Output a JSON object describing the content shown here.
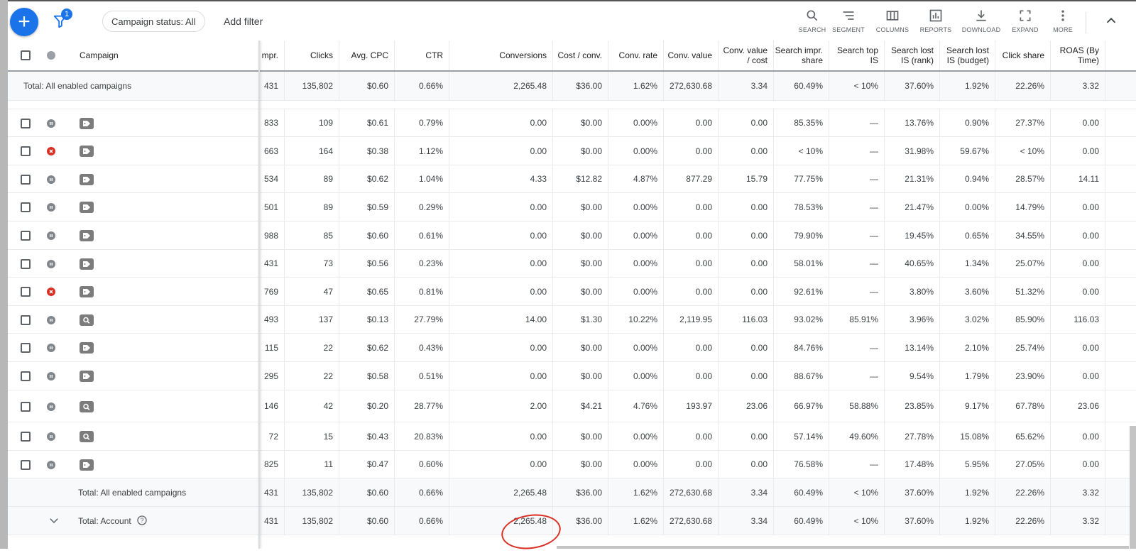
{
  "toolbar": {
    "filter_count": "1",
    "status_chip": "Campaign status: All",
    "add_filter": "Add filter",
    "tools": [
      {
        "name": "search",
        "label": "SEARCH"
      },
      {
        "name": "segment",
        "label": "SEGMENT"
      },
      {
        "name": "columns",
        "label": "COLUMNS"
      },
      {
        "name": "reports",
        "label": "REPORTS"
      },
      {
        "name": "download",
        "label": "DOWNLOAD"
      },
      {
        "name": "expand",
        "label": "EXPAND"
      },
      {
        "name": "more",
        "label": "MORE"
      }
    ]
  },
  "table": {
    "campaign_header": "Campaign",
    "columns": [
      "mpr.",
      "Clicks",
      "Avg. CPC",
      "CTR",
      "Conversions",
      "Cost / conv.",
      "Conv. rate",
      "Conv. value",
      "Conv. value / cost",
      "Search impr. share",
      "Search top IS",
      "Search lost IS (rank)",
      "Search lost IS (budget)",
      "Click share",
      "ROAS (By Time)"
    ],
    "top_total": {
      "label": "Total: All enabled campaigns",
      "values": [
        "431",
        "135,802",
        "$0.60",
        "0.66%",
        "2,265.48",
        "$36.00",
        "1.62%",
        "272,630.68",
        "3.34",
        "60.49%",
        "< 10%",
        "37.60%",
        "1.92%",
        "22.26%",
        "3.32"
      ]
    },
    "rows": [
      {
        "status": "paused",
        "type": "tag",
        "values": [
          "833",
          "109",
          "$0.61",
          "0.79%",
          "0.00",
          "$0.00",
          "0.00%",
          "0.00",
          "0.00",
          "85.35%",
          "—",
          "13.76%",
          "0.90%",
          "27.37%",
          "0.00"
        ]
      },
      {
        "status": "removed",
        "type": "tag",
        "values": [
          "663",
          "164",
          "$0.38",
          "1.12%",
          "0.00",
          "$0.00",
          "0.00%",
          "0.00",
          "0.00",
          "< 10%",
          "—",
          "31.98%",
          "59.67%",
          "< 10%",
          "0.00"
        ]
      },
      {
        "status": "paused",
        "type": "tag",
        "values": [
          "534",
          "89",
          "$0.62",
          "1.04%",
          "4.33",
          "$12.82",
          "4.87%",
          "877.29",
          "15.79",
          "77.75%",
          "—",
          "21.31%",
          "0.94%",
          "28.57%",
          "14.11"
        ]
      },
      {
        "status": "paused",
        "type": "tag",
        "values": [
          "501",
          "89",
          "$0.59",
          "0.29%",
          "0.00",
          "$0.00",
          "0.00%",
          "0.00",
          "0.00",
          "78.53%",
          "—",
          "21.47%",
          "0.00%",
          "14.79%",
          "0.00"
        ]
      },
      {
        "status": "paused",
        "type": "tag",
        "values": [
          "988",
          "85",
          "$0.60",
          "0.61%",
          "0.00",
          "$0.00",
          "0.00%",
          "0.00",
          "0.00",
          "79.90%",
          "—",
          "19.45%",
          "0.65%",
          "34.55%",
          "0.00"
        ]
      },
      {
        "status": "paused",
        "type": "tag",
        "values": [
          "431",
          "73",
          "$0.56",
          "0.23%",
          "0.00",
          "$0.00",
          "0.00%",
          "0.00",
          "0.00",
          "58.01%",
          "—",
          "40.65%",
          "1.34%",
          "25.07%",
          "0.00"
        ]
      },
      {
        "status": "removed",
        "type": "tag",
        "values": [
          "769",
          "47",
          "$0.65",
          "0.81%",
          "0.00",
          "$0.00",
          "0.00%",
          "0.00",
          "0.00",
          "92.61%",
          "—",
          "3.80%",
          "3.60%",
          "51.32%",
          "0.00"
        ]
      },
      {
        "status": "paused",
        "type": "search",
        "values": [
          "493",
          "137",
          "$0.13",
          "27.79%",
          "14.00",
          "$1.30",
          "10.22%",
          "2,119.95",
          "116.03",
          "93.02%",
          "85.91%",
          "3.96%",
          "3.02%",
          "85.90%",
          "116.03"
        ]
      },
      {
        "status": "paused",
        "type": "tag",
        "values": [
          "115",
          "22",
          "$0.62",
          "0.43%",
          "0.00",
          "$0.00",
          "0.00%",
          "0.00",
          "0.00",
          "84.76%",
          "—",
          "13.14%",
          "2.10%",
          "25.74%",
          "0.00"
        ]
      },
      {
        "status": "paused",
        "type": "tag",
        "values": [
          "295",
          "22",
          "$0.58",
          "0.51%",
          "0.00",
          "$0.00",
          "0.00%",
          "0.00",
          "0.00",
          "88.67%",
          "—",
          "9.54%",
          "1.79%",
          "23.90%",
          "0.00"
        ]
      },
      {
        "status": "paused",
        "type": "search",
        "values": [
          "146",
          "42",
          "$0.20",
          "28.77%",
          "2.00",
          "$4.21",
          "4.76%",
          "193.97",
          "23.06",
          "66.97%",
          "58.88%",
          "23.85%",
          "9.17%",
          "67.78%",
          "23.06"
        ]
      },
      {
        "status": "paused",
        "type": "search",
        "values": [
          "72",
          "15",
          "$0.43",
          "20.83%",
          "0.00",
          "$0.00",
          "0.00%",
          "0.00",
          "0.00",
          "57.14%",
          "49.60%",
          "27.78%",
          "15.08%",
          "65.62%",
          "0.00"
        ]
      },
      {
        "status": "paused",
        "type": "tag",
        "values": [
          "825",
          "11",
          "$0.47",
          "0.60%",
          "0.00",
          "$0.00",
          "0.00%",
          "0.00",
          "0.00",
          "76.58%",
          "—",
          "17.48%",
          "5.95%",
          "27.05%",
          "0.00"
        ]
      }
    ],
    "bottom_totals": [
      {
        "label": "Total: All enabled campaigns",
        "values": [
          "431",
          "135,802",
          "$0.60",
          "0.66%",
          "2,265.48",
          "$36.00",
          "1.62%",
          "272,630.68",
          "3.34",
          "60.49%",
          "< 10%",
          "37.60%",
          "1.92%",
          "22.26%",
          "3.32"
        ]
      },
      {
        "label": "Total: Account",
        "values": [
          "431",
          "135,802",
          "$0.60",
          "0.66%",
          "2,265.48",
          "$36.00",
          "1.62%",
          "272,630.68",
          "3.34",
          "60.49%",
          "< 10%",
          "37.60%",
          "1.92%",
          "22.26%",
          "3.32"
        ]
      }
    ]
  },
  "colors": {
    "accent": "#1a73e8",
    "paused": "#80868b",
    "removed": "#d93025",
    "annotation": "#d93025"
  }
}
